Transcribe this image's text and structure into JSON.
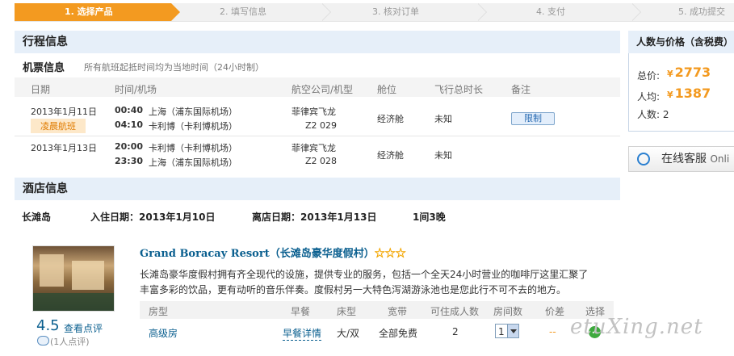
{
  "steps": [
    "1. 选择产品",
    "2. 填写信息",
    "3. 核对订单",
    "4. 支付",
    "5. 成功提交"
  ],
  "itinerary": {
    "title": "行程信息",
    "flight_title": "机票信息",
    "flight_note": "所有航班起抵时间均为当地时间（24小时制）",
    "headers": [
      "日期",
      "时间/机场",
      "航空公司/机型",
      "舱位",
      "飞行总时长",
      "备注"
    ],
    "flights": [
      {
        "date": "2013年1月11日",
        "tag": "凌晨航班",
        "dep_time": "00:40",
        "dep_airport": "上海（浦东国际机场）",
        "arr_time": "04:10",
        "arr_airport": "卡利博（卡利博机场）",
        "airline": "菲律宾飞龙",
        "flight_no": "Z2 029",
        "cabin": "经济舱",
        "duration": "未知",
        "remark": "限制"
      },
      {
        "date": "2013年1月13日",
        "dep_time": "20:00",
        "dep_airport": "卡利博（卡利博机场）",
        "arr_time": "23:30",
        "arr_airport": "上海（浦东国际机场）",
        "airline": "菲律宾飞龙",
        "flight_no": "Z2 028",
        "cabin": "经济舱",
        "duration": "未知"
      }
    ]
  },
  "hotel": {
    "title": "酒店信息",
    "city": "长滩岛",
    "checkin": "入住日期：2013年1月10日",
    "checkout": "离店日期：2013年1月13日",
    "nights": "1间3晚",
    "name": "Grand Boracay Resort（长滩岛豪华度假村）",
    "stars": "☆☆☆",
    "description": "长滩岛豪华度假村拥有齐全现代的设施，提供专业的服务，包括一个全天24小时营业的咖啡厅这里汇聚了丰富多彩的饮品，更有动听的音乐伴奏。度假村另一大特色泻湖游泳池也是您此行不可不去的地方。",
    "score": "4.5",
    "reviews_label": "查看点评",
    "review_count": "(1人点评)",
    "room_headers": [
      "房型",
      "早餐",
      "床型",
      "宽带",
      "可住成人数",
      "房间数",
      "价差",
      "选择"
    ],
    "room": {
      "type": "高级房",
      "breakfast": "早餐详情",
      "bed": "大/双",
      "broadband": "全部免费",
      "adults": "2",
      "rooms": "1",
      "price_diff": "--"
    }
  },
  "summary": {
    "title": "人数与价格（含税费）",
    "total_label": "总价:",
    "total": "2773",
    "per_label": "人均:",
    "per": "1387",
    "people_label": "人数:",
    "people": "2",
    "currency": "¥"
  },
  "service": {
    "label": "在线客服",
    "suffix": "Onli"
  },
  "watermark": "etuXing.net"
}
